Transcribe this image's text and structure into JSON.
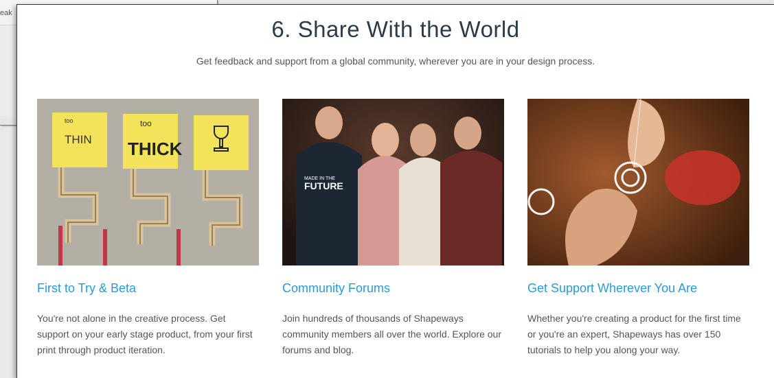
{
  "background_window": {
    "fragment": "eak"
  },
  "section": {
    "title": "6. Share With the World",
    "subtitle": "Get feedback and support from a global community, wherever you are in your design process."
  },
  "cards": [
    {
      "image": "paper-models-photo",
      "image_text": [
        "too",
        "THIN",
        "too",
        "THICK"
      ],
      "heading": "First to Try & Beta",
      "body": "You're not alone in the creative process. Get support on your early stage product, from your first print through product iteration."
    },
    {
      "image": "group-photo",
      "image_text": [
        "MADE IN THE",
        "FUTURE"
      ],
      "heading": "Community Forums",
      "body": "Join hundreds of thousands of Shapeways community members all over the world. Explore our forums and blog."
    },
    {
      "image": "hands-3d-print-photo",
      "heading": "Get Support Wherever You Are",
      "body": "Whether you're creating a product for the first time or you're an expert, Shapeways has over 150 tutorials to help you along your way."
    }
  ],
  "colors": {
    "heading_blue": "#2b9ad6",
    "title": "#2a3b4a",
    "body_text": "#555555"
  }
}
